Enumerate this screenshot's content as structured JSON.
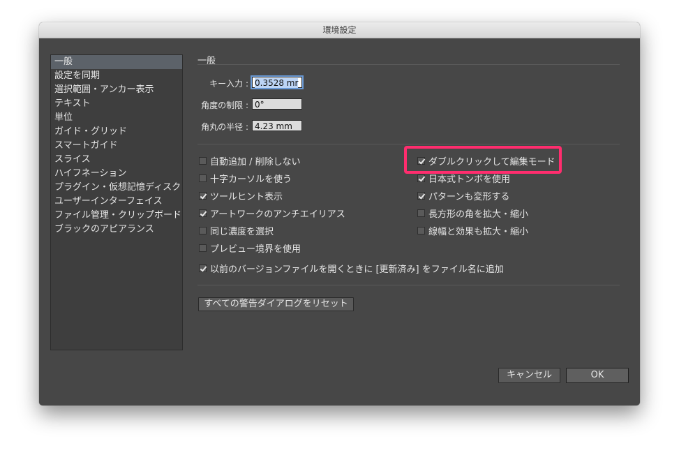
{
  "window": {
    "title": "環境設定"
  },
  "sidebar": {
    "items": [
      {
        "label": "一般"
      },
      {
        "label": "設定を同期"
      },
      {
        "label": "選択範囲・アンカー表示"
      },
      {
        "label": "テキスト"
      },
      {
        "label": "単位"
      },
      {
        "label": "ガイド・グリッド"
      },
      {
        "label": "スマートガイド"
      },
      {
        "label": "スライス"
      },
      {
        "label": "ハイフネーション"
      },
      {
        "label": "プラグイン・仮想記憶ディスク"
      },
      {
        "label": "ユーザーインターフェイス"
      },
      {
        "label": "ファイル管理・クリップボード"
      },
      {
        "label": "ブラックのアピアランス"
      }
    ],
    "selected_index": 0
  },
  "general": {
    "section_title": "一般",
    "key_input": {
      "label": "キー入力 :",
      "value": "0.3528 mr"
    },
    "angle_limit": {
      "label": "角度の制限 :",
      "value": "0°"
    },
    "corner_radius": {
      "label": "角丸の半径 :",
      "value": "4.23 mm"
    }
  },
  "options": {
    "left": [
      {
        "label": "自動追加 / 削除しない",
        "checked": false
      },
      {
        "label": "十字カーソルを使う",
        "checked": false
      },
      {
        "label": "ツールヒント表示",
        "checked": true
      },
      {
        "label": "アートワークのアンチエイリアス",
        "checked": true
      },
      {
        "label": "同じ濃度を選択",
        "checked": false
      },
      {
        "label": "プレビュー境界を使用",
        "checked": false
      }
    ],
    "right": [
      {
        "label": "ダブルクリックして編集モード",
        "checked": true
      },
      {
        "label": "日本式トンボを使用",
        "checked": true
      },
      {
        "label": "パターンも変形する",
        "checked": true
      },
      {
        "label": "長方形の角を拡大・縮小",
        "checked": false
      },
      {
        "label": "線幅と効果も拡大・縮小",
        "checked": false
      }
    ],
    "append_updated": {
      "label": "以前のバージョンファイルを開くときに [更新済み] をファイル名に追加",
      "checked": true
    }
  },
  "buttons": {
    "reset_warnings": "すべての警告ダイアログをリセット",
    "cancel": "キャンセル",
    "ok": "OK"
  },
  "colors": {
    "highlight": "#ff2d6e",
    "dialog_bg": "#474747",
    "selection": "#5c6269"
  }
}
